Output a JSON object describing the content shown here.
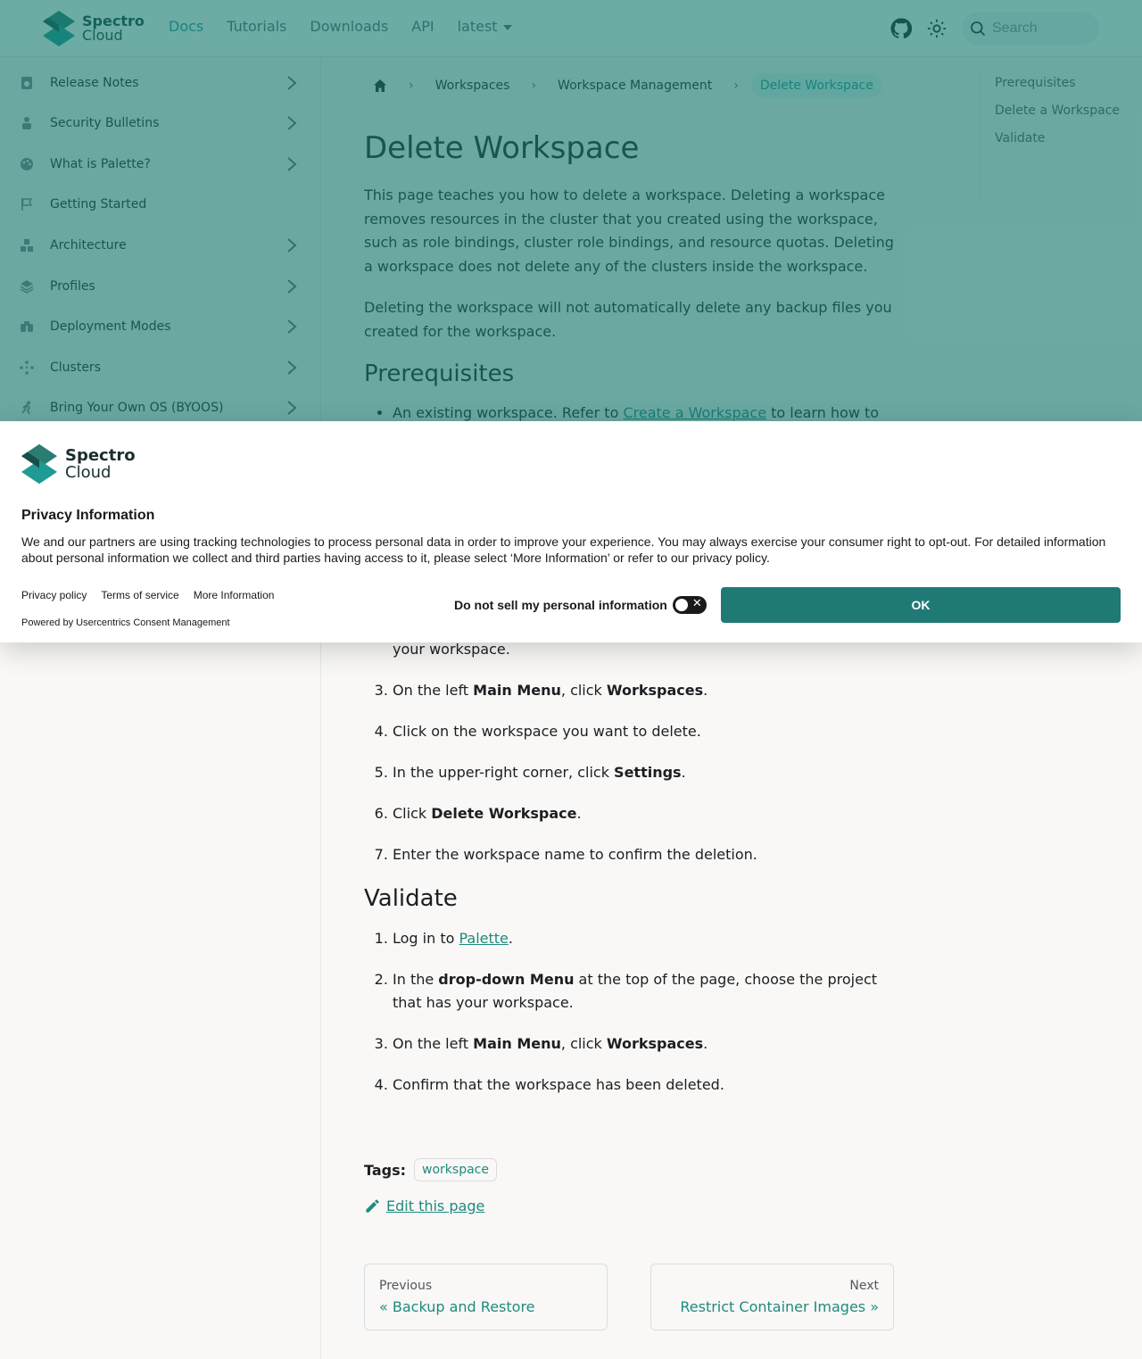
{
  "navbar": {
    "logo_line1": "Spectro",
    "logo_line2": "Cloud",
    "items": [
      {
        "label": "Docs"
      },
      {
        "label": "Tutorials"
      },
      {
        "label": "Downloads"
      },
      {
        "label": "API"
      },
      {
        "label": "latest"
      }
    ],
    "search_placeholder": "Search"
  },
  "sidebar": {
    "items": [
      {
        "label": "Release Notes",
        "icon": "document-icon",
        "expandable": true
      },
      {
        "label": "Security Bulletins",
        "icon": "shield-user-icon",
        "expandable": true
      },
      {
        "label": "What is Palette?",
        "icon": "palette-icon",
        "expandable": true
      },
      {
        "label": "Getting Started",
        "icon": "flag-icon",
        "expandable": false
      },
      {
        "label": "Architecture",
        "icon": "cubes-icon",
        "expandable": true
      },
      {
        "label": "Profiles",
        "icon": "layers-icon",
        "expandable": true
      },
      {
        "label": "Deployment Modes",
        "icon": "binoculars-icon",
        "expandable": true
      },
      {
        "label": "Clusters",
        "icon": "nodes-icon",
        "expandable": true
      },
      {
        "label": "Bring Your Own OS (BYOOS)",
        "icon": "running-icon",
        "expandable": true
      }
    ]
  },
  "breadcrumbs": {
    "items": [
      "Workspaces",
      "Workspace Management"
    ],
    "current": "Delete Workspace"
  },
  "article": {
    "title": "Delete Workspace",
    "intro": "This page teaches you how to delete a workspace. Deleting a workspace removes resources in the cluster that you created using the workspace, such as role bindings, cluster role bindings, and resource quotas. Deleting a workspace does not delete any of the clusters inside the workspace.",
    "note": "Deleting the workspace will not automatically delete any backup files you created for the workspace.",
    "prereq_heading": "Prerequisites",
    "prereq_item_before": "An existing workspace. Refer to ",
    "prereq_item_link": "Create a Workspace",
    "prereq_item_after": " to learn how to create",
    "enablement_tail": "your workspace.",
    "enablement_steps": [
      {
        "pre": "On the left ",
        "b1": "Main Menu",
        "mid": ", click ",
        "b2": "Workspaces",
        "post": "."
      },
      {
        "pre": "Click on the workspace you want to delete.",
        "b1": "",
        "mid": "",
        "b2": "",
        "post": ""
      },
      {
        "pre": "In the upper-right corner, click ",
        "b1": "Settings",
        "mid": "",
        "b2": "",
        "post": "."
      },
      {
        "pre": "Click ",
        "b1": "Delete Workspace",
        "mid": "",
        "b2": "",
        "post": "."
      },
      {
        "pre": "Enter the workspace name to confirm the deletion.",
        "b1": "",
        "mid": "",
        "b2": "",
        "post": ""
      }
    ],
    "validate_heading": "Validate",
    "validate_steps": {
      "s1_pre": "Log in to ",
      "s1_link": "Palette",
      "s1_post": ".",
      "s2_pre": "In the ",
      "s2_b": "drop-down Menu",
      "s2_post": " at the top of the page, choose the project that has your workspace.",
      "s3_pre": "On the left ",
      "s3_b1": "Main Menu",
      "s3_mid": ", click ",
      "s3_b2": "Workspaces",
      "s3_post": ".",
      "s4": "Confirm that the workspace has been deleted."
    },
    "tags_label": "Tags:",
    "tags": [
      "workspace"
    ],
    "edit_label": "Edit this page",
    "prev_sub": "Previous",
    "prev_title": "« Backup and Restore",
    "next_sub": "Next",
    "next_title": "Restrict Container Images »"
  },
  "toc": {
    "items": [
      "Prerequisites",
      "Delete a Workspace",
      "Validate"
    ]
  },
  "consent": {
    "title": "Privacy Information",
    "text": "We and our partners are using tracking technologies to process personal data in order to improve your experience. You may always exercise your consumer right to opt-out. For detailed information about personal information we collect and third parties having access to it, please select ‘More Information’ or refer to our privacy policy.",
    "links": [
      "Privacy policy",
      "Terms of service",
      "More Information"
    ],
    "powered": "Powered by Usercentrics Consent Management",
    "dns_label": "Do not sell my personal information",
    "ok_label": "OK"
  },
  "colors": {
    "accent": "#1f9a94",
    "overlay": "#3a8f88",
    "ok_button": "#1f7a76"
  }
}
